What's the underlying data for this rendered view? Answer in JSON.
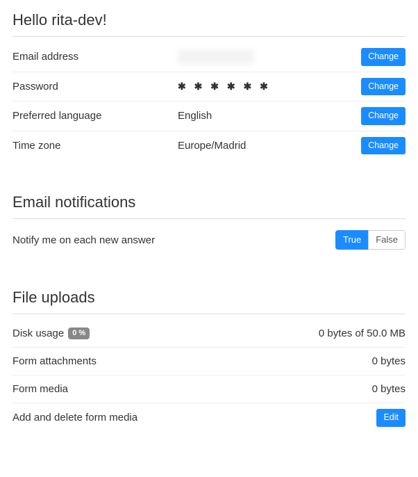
{
  "greeting": "Hello rita-dev!",
  "account": {
    "email": {
      "label": "Email address",
      "value": " ",
      "action": "Change"
    },
    "password": {
      "label": "Password",
      "value": "✱ ✱ ✱ ✱ ✱ ✱",
      "action": "Change"
    },
    "language": {
      "label": "Preferred language",
      "value": "English",
      "action": "Change"
    },
    "timezone": {
      "label": "Time zone",
      "value": "Europe/Madrid",
      "action": "Change"
    }
  },
  "notifications": {
    "heading": "Email notifications",
    "notify_new_answer": {
      "label": "Notify me on each new answer",
      "true_label": "True",
      "false_label": "False",
      "value": true
    }
  },
  "uploads": {
    "heading": "File uploads",
    "disk_usage": {
      "label": "Disk usage",
      "badge": "0 %",
      "value": "0 bytes of 50.0 MB"
    },
    "attachments": {
      "label": "Form attachments",
      "value": "0 bytes"
    },
    "media": {
      "label": "Form media",
      "value": "0 bytes"
    },
    "edit_media": {
      "label": "Add and delete form media",
      "action": "Edit"
    }
  }
}
